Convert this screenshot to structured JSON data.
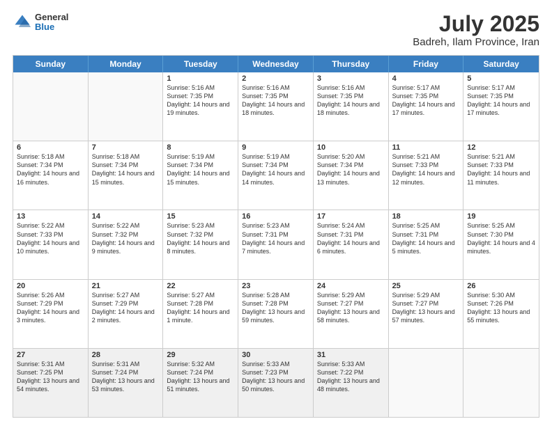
{
  "header": {
    "logo": {
      "general": "General",
      "blue": "Blue"
    },
    "month": "July 2025",
    "location": "Badreh, Ilam Province, Iran"
  },
  "days": [
    "Sunday",
    "Monday",
    "Tuesday",
    "Wednesday",
    "Thursday",
    "Friday",
    "Saturday"
  ],
  "weeks": [
    [
      {
        "day": "",
        "empty": true
      },
      {
        "day": "",
        "empty": true
      },
      {
        "day": "1",
        "sunrise": "Sunrise: 5:16 AM",
        "sunset": "Sunset: 7:35 PM",
        "daylight": "Daylight: 14 hours and 19 minutes."
      },
      {
        "day": "2",
        "sunrise": "Sunrise: 5:16 AM",
        "sunset": "Sunset: 7:35 PM",
        "daylight": "Daylight: 14 hours and 18 minutes."
      },
      {
        "day": "3",
        "sunrise": "Sunrise: 5:16 AM",
        "sunset": "Sunset: 7:35 PM",
        "daylight": "Daylight: 14 hours and 18 minutes."
      },
      {
        "day": "4",
        "sunrise": "Sunrise: 5:17 AM",
        "sunset": "Sunset: 7:35 PM",
        "daylight": "Daylight: 14 hours and 17 minutes."
      },
      {
        "day": "5",
        "sunrise": "Sunrise: 5:17 AM",
        "sunset": "Sunset: 7:35 PM",
        "daylight": "Daylight: 14 hours and 17 minutes."
      }
    ],
    [
      {
        "day": "6",
        "sunrise": "Sunrise: 5:18 AM",
        "sunset": "Sunset: 7:34 PM",
        "daylight": "Daylight: 14 hours and 16 minutes."
      },
      {
        "day": "7",
        "sunrise": "Sunrise: 5:18 AM",
        "sunset": "Sunset: 7:34 PM",
        "daylight": "Daylight: 14 hours and 15 minutes."
      },
      {
        "day": "8",
        "sunrise": "Sunrise: 5:19 AM",
        "sunset": "Sunset: 7:34 PM",
        "daylight": "Daylight: 14 hours and 15 minutes."
      },
      {
        "day": "9",
        "sunrise": "Sunrise: 5:19 AM",
        "sunset": "Sunset: 7:34 PM",
        "daylight": "Daylight: 14 hours and 14 minutes."
      },
      {
        "day": "10",
        "sunrise": "Sunrise: 5:20 AM",
        "sunset": "Sunset: 7:34 PM",
        "daylight": "Daylight: 14 hours and 13 minutes."
      },
      {
        "day": "11",
        "sunrise": "Sunrise: 5:21 AM",
        "sunset": "Sunset: 7:33 PM",
        "daylight": "Daylight: 14 hours and 12 minutes."
      },
      {
        "day": "12",
        "sunrise": "Sunrise: 5:21 AM",
        "sunset": "Sunset: 7:33 PM",
        "daylight": "Daylight: 14 hours and 11 minutes."
      }
    ],
    [
      {
        "day": "13",
        "sunrise": "Sunrise: 5:22 AM",
        "sunset": "Sunset: 7:33 PM",
        "daylight": "Daylight: 14 hours and 10 minutes."
      },
      {
        "day": "14",
        "sunrise": "Sunrise: 5:22 AM",
        "sunset": "Sunset: 7:32 PM",
        "daylight": "Daylight: 14 hours and 9 minutes."
      },
      {
        "day": "15",
        "sunrise": "Sunrise: 5:23 AM",
        "sunset": "Sunset: 7:32 PM",
        "daylight": "Daylight: 14 hours and 8 minutes."
      },
      {
        "day": "16",
        "sunrise": "Sunrise: 5:23 AM",
        "sunset": "Sunset: 7:31 PM",
        "daylight": "Daylight: 14 hours and 7 minutes."
      },
      {
        "day": "17",
        "sunrise": "Sunrise: 5:24 AM",
        "sunset": "Sunset: 7:31 PM",
        "daylight": "Daylight: 14 hours and 6 minutes."
      },
      {
        "day": "18",
        "sunrise": "Sunrise: 5:25 AM",
        "sunset": "Sunset: 7:31 PM",
        "daylight": "Daylight: 14 hours and 5 minutes."
      },
      {
        "day": "19",
        "sunrise": "Sunrise: 5:25 AM",
        "sunset": "Sunset: 7:30 PM",
        "daylight": "Daylight: 14 hours and 4 minutes."
      }
    ],
    [
      {
        "day": "20",
        "sunrise": "Sunrise: 5:26 AM",
        "sunset": "Sunset: 7:29 PM",
        "daylight": "Daylight: 14 hours and 3 minutes."
      },
      {
        "day": "21",
        "sunrise": "Sunrise: 5:27 AM",
        "sunset": "Sunset: 7:29 PM",
        "daylight": "Daylight: 14 hours and 2 minutes."
      },
      {
        "day": "22",
        "sunrise": "Sunrise: 5:27 AM",
        "sunset": "Sunset: 7:28 PM",
        "daylight": "Daylight: 14 hours and 1 minute."
      },
      {
        "day": "23",
        "sunrise": "Sunrise: 5:28 AM",
        "sunset": "Sunset: 7:28 PM",
        "daylight": "Daylight: 13 hours and 59 minutes."
      },
      {
        "day": "24",
        "sunrise": "Sunrise: 5:29 AM",
        "sunset": "Sunset: 7:27 PM",
        "daylight": "Daylight: 13 hours and 58 minutes."
      },
      {
        "day": "25",
        "sunrise": "Sunrise: 5:29 AM",
        "sunset": "Sunset: 7:27 PM",
        "daylight": "Daylight: 13 hours and 57 minutes."
      },
      {
        "day": "26",
        "sunrise": "Sunrise: 5:30 AM",
        "sunset": "Sunset: 7:26 PM",
        "daylight": "Daylight: 13 hours and 55 minutes."
      }
    ],
    [
      {
        "day": "27",
        "sunrise": "Sunrise: 5:31 AM",
        "sunset": "Sunset: 7:25 PM",
        "daylight": "Daylight: 13 hours and 54 minutes."
      },
      {
        "day": "28",
        "sunrise": "Sunrise: 5:31 AM",
        "sunset": "Sunset: 7:24 PM",
        "daylight": "Daylight: 13 hours and 53 minutes."
      },
      {
        "day": "29",
        "sunrise": "Sunrise: 5:32 AM",
        "sunset": "Sunset: 7:24 PM",
        "daylight": "Daylight: 13 hours and 51 minutes."
      },
      {
        "day": "30",
        "sunrise": "Sunrise: 5:33 AM",
        "sunset": "Sunset: 7:23 PM",
        "daylight": "Daylight: 13 hours and 50 minutes."
      },
      {
        "day": "31",
        "sunrise": "Sunrise: 5:33 AM",
        "sunset": "Sunset: 7:22 PM",
        "daylight": "Daylight: 13 hours and 48 minutes."
      },
      {
        "day": "",
        "empty": true
      },
      {
        "day": "",
        "empty": true
      }
    ]
  ]
}
